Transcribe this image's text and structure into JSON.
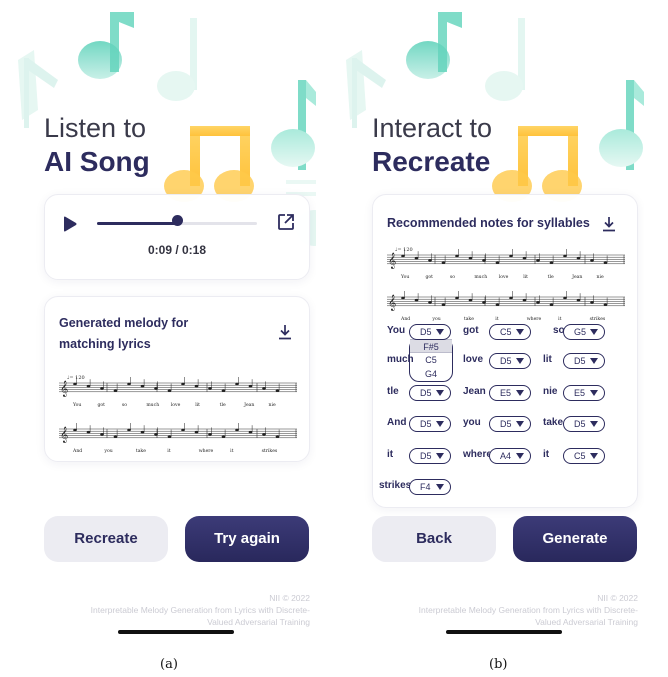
{
  "panel_a": {
    "hero": {
      "line1": "Listen to",
      "line2": "AI Song"
    },
    "player": {
      "time": "0:09 / 0:18",
      "progress": 0.5
    },
    "melody_card": {
      "title_line1": "Generated melody for",
      "title_line2": "matching lyrics"
    },
    "buttons": {
      "left": "Recreate",
      "right": "Try again"
    },
    "caption": "(a)"
  },
  "panel_b": {
    "hero": {
      "line1": "Interact to",
      "line2": "Recreate"
    },
    "melody_card": {
      "title": "Recommended notes  for syllables",
      "rows": [
        [
          {
            "syllable": "You",
            "note": "D5"
          },
          {
            "syllable": "got",
            "note": "C5"
          },
          {
            "syllable": "so",
            "note": "G5"
          }
        ],
        [
          {
            "syllable": "much",
            "note": ""
          },
          {
            "syllable": "love",
            "note": "D5"
          },
          {
            "syllable": "lit",
            "note": "D5"
          }
        ],
        [
          {
            "syllable": "tle",
            "note": "D5"
          },
          {
            "syllable": "Jean",
            "note": "E5"
          },
          {
            "syllable": "nie",
            "note": "E5"
          }
        ],
        [
          {
            "syllable": "And",
            "note": "D5"
          },
          {
            "syllable": "you",
            "note": "D5"
          },
          {
            "syllable": "take",
            "note": "D5"
          }
        ],
        [
          {
            "syllable": "it",
            "note": "D5"
          },
          {
            "syllable": "where",
            "note": "A4"
          },
          {
            "syllable": "it",
            "note": "C5"
          }
        ],
        [
          {
            "syllable": "strikes",
            "note": "F4"
          }
        ]
      ],
      "dropdown_options": [
        "F#5",
        "C5",
        "G4"
      ],
      "dropdown_selected": "F#5"
    },
    "buttons": {
      "left": "Back",
      "right": "Generate"
    },
    "caption": "(b)"
  },
  "score": {
    "tempo": "♩= 120",
    "line1_lyrics": [
      "You",
      "got",
      "so",
      "much",
      "love",
      "lit",
      "tle",
      "Jean",
      "nie"
    ],
    "line2_lyrics": [
      "And",
      "you",
      "take",
      "it",
      "where",
      "it",
      "strikes"
    ]
  },
  "footer": {
    "copyright": "NII © 2022",
    "line1": "Interpretable Melody Generation from Lyrics with Discrete-",
    "line2": "Valued Adversarial Training"
  },
  "icons": [
    "play-icon",
    "share-icon",
    "download-icon",
    "music-note-icon",
    "chevron-down-icon"
  ],
  "colors": {
    "navy": "#2d2c5e",
    "teal": "#5fcfb8",
    "yellow": "#ffc94a",
    "light_button": "#ececf2"
  }
}
